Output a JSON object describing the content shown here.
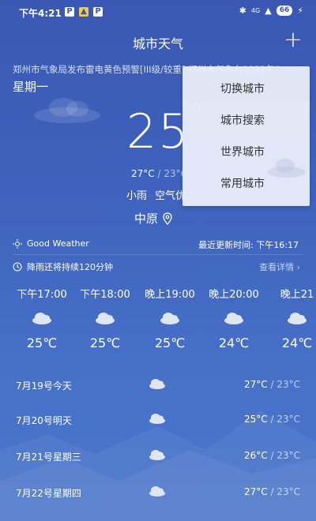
{
  "status_bar": {
    "time": "下午4:21",
    "network": "4G",
    "battery": "66"
  },
  "header": {
    "title": "城市天气",
    "add_label": "+"
  },
  "ticker": "郑州市气象局发布雷电黄色预警[III级/较重]   郑州市气象台2021年0",
  "weekday": "星期一",
  "current": {
    "temp": "25",
    "unit": "°C",
    "high": "27°C",
    "sep": "/",
    "low": "23°C",
    "condition": "小雨",
    "aqi": "空气优",
    "city": "中原"
  },
  "menu": {
    "items": [
      "切换城市",
      "城市搜索",
      "世界城市",
      "常用城市"
    ]
  },
  "info": {
    "good_weather": "Good Weather",
    "update_label": "最近更新时间: 下午16:17",
    "rain_note": "降雨还将持续120分钟",
    "details_link": "查看详情 ›"
  },
  "hourly": [
    {
      "time": "下午17:00",
      "temp": "25℃"
    },
    {
      "time": "下午18:00",
      "temp": "25℃"
    },
    {
      "time": "晚上19:00",
      "temp": "25℃"
    },
    {
      "time": "晚上20:00",
      "temp": "24℃"
    },
    {
      "time": "晚上21",
      "temp": "24℃"
    }
  ],
  "daily": [
    {
      "label": "7月19号今天",
      "high": "27°C",
      "low": "23°C"
    },
    {
      "label": "7月20号明天",
      "high": "25°C",
      "low": "23°C"
    },
    {
      "label": "7月21号星期三",
      "high": "26°C",
      "low": "23°C"
    },
    {
      "label": "7月22号星期四",
      "high": "27°C",
      "low": "23°C"
    }
  ],
  "daily_sep": " / ",
  "colors": {
    "bg_top": "#3a58b3",
    "bg_bottom": "#4b77cc",
    "menu_bg": "#e8ecf8",
    "menu_text": "#333333"
  }
}
